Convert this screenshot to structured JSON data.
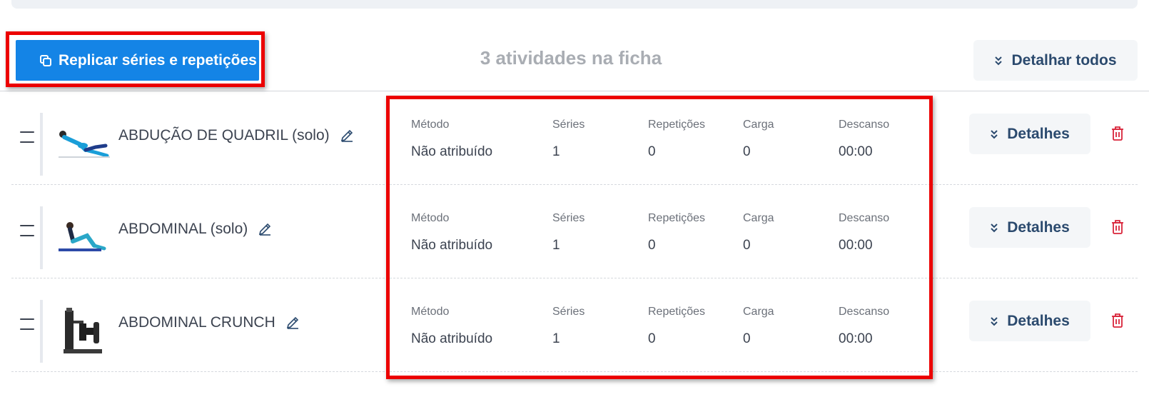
{
  "toolbar": {
    "replicate_label": "Replicar séries e repetições",
    "activity_count": "3 atividades na ficha",
    "detail_all_label": "Detalhar todos"
  },
  "colors": {
    "primary": "#1484e6",
    "highlight": "#ec0000",
    "delete": "#d9243a",
    "secondary_text": "#2b4a6e"
  },
  "exercises": [
    {
      "name": "ABDUÇÃO DE QUADRIL (solo)",
      "image_icon": "exercise-hip-abduction-image",
      "stats": {
        "labels": [
          "Método",
          "Séries",
          "Repetições",
          "Carga",
          "Descanso"
        ],
        "values": [
          "Não atribuído",
          "1",
          "0",
          "0",
          "00:00"
        ]
      },
      "details_label": "Detalhes"
    },
    {
      "name": "ABDOMINAL (solo)",
      "image_icon": "exercise-abdominal-image",
      "stats": {
        "labels": [
          "Método",
          "Séries",
          "Repetições",
          "Carga",
          "Descanso"
        ],
        "values": [
          "Não atribuído",
          "1",
          "0",
          "0",
          "00:00"
        ]
      },
      "details_label": "Detalhes"
    },
    {
      "name": "ABDOMINAL CRUNCH",
      "image_icon": "exercise-crunch-machine-image",
      "stats": {
        "labels": [
          "Método",
          "Séries",
          "Repetições",
          "Carga",
          "Descanso"
        ],
        "values": [
          "Não atribuído",
          "1",
          "0",
          "0",
          "00:00"
        ]
      },
      "details_label": "Detalhes"
    }
  ]
}
